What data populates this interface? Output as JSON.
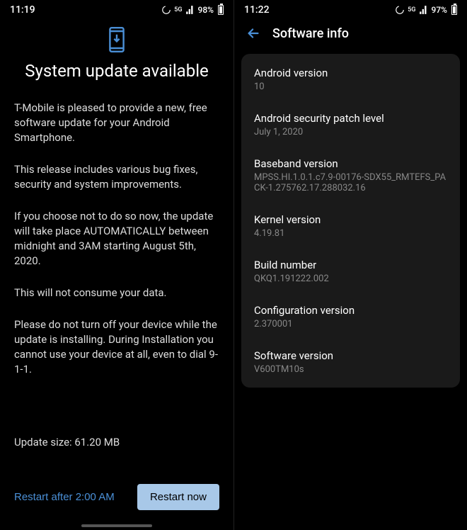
{
  "left": {
    "status": {
      "time": "11:19",
      "battery": "98%"
    },
    "title": "System update available",
    "paragraphs": [
      "T-Mobile is pleased to provide a new, free software update for your Android Smartphone.",
      "This release includes various bug fixes, security and system improvements.",
      "If you choose not to do so now, the update will take place AUTOMATICALLY between midnight and 3AM starting August 5th, 2020.",
      "This will not consume your data.",
      "Please do not turn off your device while the update is installing. During Installation you cannot use your device at all, even to dial 9-1-1."
    ],
    "update_size": "Update size: 61.20 MB",
    "buttons": {
      "later": "Restart after 2:00 AM",
      "now": "Restart now"
    }
  },
  "right": {
    "status": {
      "time": "11:22",
      "battery": "97%"
    },
    "header": "Software info",
    "items": [
      {
        "label": "Android version",
        "value": "10"
      },
      {
        "label": "Android security patch level",
        "value": "July 1, 2020"
      },
      {
        "label": "Baseband version",
        "value": "MPSS.HI.1.0.1.c7.9-00176-SDX55_RMTEFS_PACK-1.275762.17.288032.16"
      },
      {
        "label": "Kernel version",
        "value": "4.19.81"
      },
      {
        "label": "Build number",
        "value": "QKQ1.191222.002"
      },
      {
        "label": "Configuration version",
        "value": "2.370001"
      },
      {
        "label": "Software version",
        "value": "V600TM10s"
      }
    ]
  }
}
